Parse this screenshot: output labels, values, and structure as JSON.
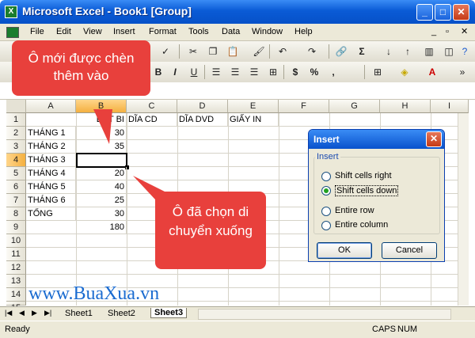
{
  "window": {
    "title": "Microsoft Excel - Book1  [Group]",
    "app_icon": "X"
  },
  "menu": [
    "File",
    "Edit",
    "View",
    "Insert",
    "Format",
    "Tools",
    "Data",
    "Window",
    "Help"
  ],
  "columns": [
    "A",
    "B",
    "C",
    "D",
    "E",
    "F",
    "G",
    "H",
    "I"
  ],
  "rows": [
    "1",
    "2",
    "3",
    "4",
    "5",
    "6",
    "7",
    "8",
    "9",
    "10",
    "11",
    "12",
    "13",
    "14",
    "15"
  ],
  "cells": {
    "B1": "BÚT BI",
    "C1": "DĨA CD",
    "D1": "DĨA DVD",
    "E1": "GIẤY IN",
    "A2": "THÁNG 1",
    "B2": "30",
    "A3": "THÁNG 2",
    "B3": "35",
    "A4": "THÁNG 3",
    "A5": "THÁNG 4",
    "B5": "20",
    "A6": "THÁNG 5",
    "B6": "40",
    "A7": "THÁNG 6",
    "B7": "25",
    "A8": "TỔNG",
    "B8": "30",
    "B9": "180"
  },
  "callouts": {
    "top": "Ô mới được chèn thêm vào",
    "bottom": "Ô đã chọn di chuyển xuống"
  },
  "watermark": "www.BuaXua.vn",
  "dialog": {
    "title": "Insert",
    "group": "Insert",
    "options": [
      "Shift cells right",
      "Shift cells down",
      "Entire row",
      "Entire column"
    ],
    "selected": 1,
    "ok": "OK",
    "cancel": "Cancel"
  },
  "sheets": [
    "Sheet1",
    "Sheet2",
    "Sheet3"
  ],
  "active_sheet": 2,
  "status": {
    "left": "Ready",
    "caps": "CAPS",
    "num": "NUM"
  },
  "colors": {
    "callout": "#e8403c",
    "titlebar": "#0a5bd6",
    "highlight": "#cc3333"
  }
}
